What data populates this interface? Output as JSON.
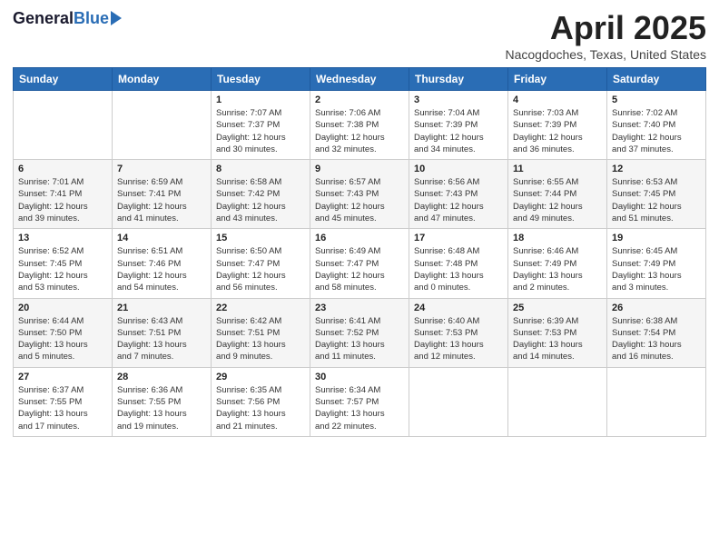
{
  "header": {
    "logo_general": "General",
    "logo_blue": "Blue",
    "title": "April 2025",
    "location": "Nacogdoches, Texas, United States"
  },
  "days_of_week": [
    "Sunday",
    "Monday",
    "Tuesday",
    "Wednesday",
    "Thursday",
    "Friday",
    "Saturday"
  ],
  "weeks": [
    [
      {
        "day": "",
        "info": ""
      },
      {
        "day": "",
        "info": ""
      },
      {
        "day": "1",
        "info": "Sunrise: 7:07 AM\nSunset: 7:37 PM\nDaylight: 12 hours\nand 30 minutes."
      },
      {
        "day": "2",
        "info": "Sunrise: 7:06 AM\nSunset: 7:38 PM\nDaylight: 12 hours\nand 32 minutes."
      },
      {
        "day": "3",
        "info": "Sunrise: 7:04 AM\nSunset: 7:39 PM\nDaylight: 12 hours\nand 34 minutes."
      },
      {
        "day": "4",
        "info": "Sunrise: 7:03 AM\nSunset: 7:39 PM\nDaylight: 12 hours\nand 36 minutes."
      },
      {
        "day": "5",
        "info": "Sunrise: 7:02 AM\nSunset: 7:40 PM\nDaylight: 12 hours\nand 37 minutes."
      }
    ],
    [
      {
        "day": "6",
        "info": "Sunrise: 7:01 AM\nSunset: 7:41 PM\nDaylight: 12 hours\nand 39 minutes."
      },
      {
        "day": "7",
        "info": "Sunrise: 6:59 AM\nSunset: 7:41 PM\nDaylight: 12 hours\nand 41 minutes."
      },
      {
        "day": "8",
        "info": "Sunrise: 6:58 AM\nSunset: 7:42 PM\nDaylight: 12 hours\nand 43 minutes."
      },
      {
        "day": "9",
        "info": "Sunrise: 6:57 AM\nSunset: 7:43 PM\nDaylight: 12 hours\nand 45 minutes."
      },
      {
        "day": "10",
        "info": "Sunrise: 6:56 AM\nSunset: 7:43 PM\nDaylight: 12 hours\nand 47 minutes."
      },
      {
        "day": "11",
        "info": "Sunrise: 6:55 AM\nSunset: 7:44 PM\nDaylight: 12 hours\nand 49 minutes."
      },
      {
        "day": "12",
        "info": "Sunrise: 6:53 AM\nSunset: 7:45 PM\nDaylight: 12 hours\nand 51 minutes."
      }
    ],
    [
      {
        "day": "13",
        "info": "Sunrise: 6:52 AM\nSunset: 7:45 PM\nDaylight: 12 hours\nand 53 minutes."
      },
      {
        "day": "14",
        "info": "Sunrise: 6:51 AM\nSunset: 7:46 PM\nDaylight: 12 hours\nand 54 minutes."
      },
      {
        "day": "15",
        "info": "Sunrise: 6:50 AM\nSunset: 7:47 PM\nDaylight: 12 hours\nand 56 minutes."
      },
      {
        "day": "16",
        "info": "Sunrise: 6:49 AM\nSunset: 7:47 PM\nDaylight: 12 hours\nand 58 minutes."
      },
      {
        "day": "17",
        "info": "Sunrise: 6:48 AM\nSunset: 7:48 PM\nDaylight: 13 hours\nand 0 minutes."
      },
      {
        "day": "18",
        "info": "Sunrise: 6:46 AM\nSunset: 7:49 PM\nDaylight: 13 hours\nand 2 minutes."
      },
      {
        "day": "19",
        "info": "Sunrise: 6:45 AM\nSunset: 7:49 PM\nDaylight: 13 hours\nand 3 minutes."
      }
    ],
    [
      {
        "day": "20",
        "info": "Sunrise: 6:44 AM\nSunset: 7:50 PM\nDaylight: 13 hours\nand 5 minutes."
      },
      {
        "day": "21",
        "info": "Sunrise: 6:43 AM\nSunset: 7:51 PM\nDaylight: 13 hours\nand 7 minutes."
      },
      {
        "day": "22",
        "info": "Sunrise: 6:42 AM\nSunset: 7:51 PM\nDaylight: 13 hours\nand 9 minutes."
      },
      {
        "day": "23",
        "info": "Sunrise: 6:41 AM\nSunset: 7:52 PM\nDaylight: 13 hours\nand 11 minutes."
      },
      {
        "day": "24",
        "info": "Sunrise: 6:40 AM\nSunset: 7:53 PM\nDaylight: 13 hours\nand 12 minutes."
      },
      {
        "day": "25",
        "info": "Sunrise: 6:39 AM\nSunset: 7:53 PM\nDaylight: 13 hours\nand 14 minutes."
      },
      {
        "day": "26",
        "info": "Sunrise: 6:38 AM\nSunset: 7:54 PM\nDaylight: 13 hours\nand 16 minutes."
      }
    ],
    [
      {
        "day": "27",
        "info": "Sunrise: 6:37 AM\nSunset: 7:55 PM\nDaylight: 13 hours\nand 17 minutes."
      },
      {
        "day": "28",
        "info": "Sunrise: 6:36 AM\nSunset: 7:55 PM\nDaylight: 13 hours\nand 19 minutes."
      },
      {
        "day": "29",
        "info": "Sunrise: 6:35 AM\nSunset: 7:56 PM\nDaylight: 13 hours\nand 21 minutes."
      },
      {
        "day": "30",
        "info": "Sunrise: 6:34 AM\nSunset: 7:57 PM\nDaylight: 13 hours\nand 22 minutes."
      },
      {
        "day": "",
        "info": ""
      },
      {
        "day": "",
        "info": ""
      },
      {
        "day": "",
        "info": ""
      }
    ]
  ]
}
